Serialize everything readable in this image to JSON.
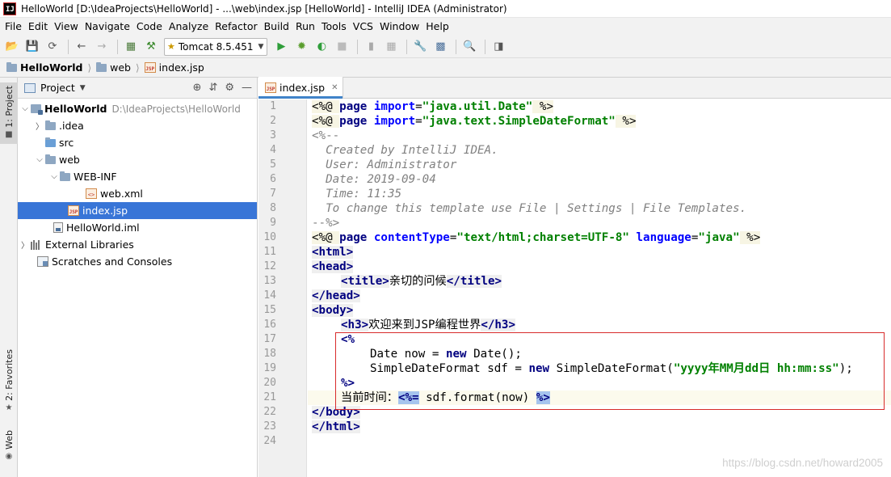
{
  "window": {
    "title": "HelloWorld [D:\\IdeaProjects\\HelloWorld] - ...\\web\\index.jsp [HelloWorld] - IntelliJ IDEA (Administrator)",
    "app_icon": "IJ"
  },
  "menu": [
    "File",
    "Edit",
    "View",
    "Navigate",
    "Code",
    "Analyze",
    "Refactor",
    "Build",
    "Run",
    "Tools",
    "VCS",
    "Window",
    "Help"
  ],
  "toolbar": {
    "run_config": "Tomcat 8.5.451"
  },
  "breadcrumb": [
    "HelloWorld",
    "web",
    "index.jsp"
  ],
  "left_strip": {
    "project_tab": "1: Project",
    "favorites_tab": "2: Favorites",
    "web_tab": "Web"
  },
  "project_panel": {
    "title": "Project",
    "tree": [
      {
        "label": "HelloWorld",
        "path": "D:\\IdeaProjects\\HelloWorld"
      },
      {
        "label": ".idea"
      },
      {
        "label": "src"
      },
      {
        "label": "web"
      },
      {
        "label": "WEB-INF"
      },
      {
        "label": "web.xml"
      },
      {
        "label": "index.jsp"
      },
      {
        "label": "HelloWorld.iml"
      },
      {
        "label": "External Libraries"
      },
      {
        "label": "Scratches and Consoles"
      }
    ]
  },
  "editor": {
    "tab_label": "index.jsp",
    "line_numbers": [
      "1",
      "2",
      "3",
      "4",
      "5",
      "6",
      "7",
      "8",
      "9",
      "10",
      "11",
      "12",
      "13",
      "14",
      "15",
      "16",
      "17",
      "18",
      "19",
      "20",
      "21",
      "22",
      "23",
      "24"
    ],
    "lines": {
      "l1": {
        "open": "<%@ ",
        "kw": "page",
        "attr": "import",
        "eq": "=",
        "str": "\"java.util.Date\"",
        "close": " %>"
      },
      "l2": {
        "open": "<%@ ",
        "kw": "page",
        "attr": "import",
        "eq": "=",
        "str": "\"java.text.SimpleDateFormat\"",
        "close": " %>"
      },
      "l3": "<%--",
      "l4": "  Created by IntelliJ IDEA.",
      "l5": "  User: Administrator",
      "l6": "  Date: 2019-09-04",
      "l7": "  Time: 11:35",
      "l8": "  To change this template use File | Settings | File Templates.",
      "l9": "--%>",
      "l10": {
        "open": "<%@ ",
        "kw": "page",
        "attr1": "contentType",
        "str1": "\"text/html;charset=UTF-8\"",
        "attr2": "language",
        "str2": "\"java\"",
        "close": " %>"
      },
      "l11": "<html>",
      "l12": "<head>",
      "l13": {
        "open": "<title>",
        "text": "亲切的问候",
        "close": "</title>"
      },
      "l14": "</head>",
      "l15": "<body>",
      "l16": {
        "open": "<h3>",
        "text": "欢迎来到JSP编程世界",
        "close": "</h3>"
      },
      "l17": "<%",
      "l18": {
        "type": "Date now = ",
        "kw": "new",
        "rest": " Date();"
      },
      "l19": {
        "type": "SimpleDateFormat sdf = ",
        "kw": "new",
        "rest": " SimpleDateFormat(",
        "str": "\"yyyy年MM月dd日 hh:mm:ss\"",
        "end": ");"
      },
      "l20": "%>",
      "l21": {
        "text": "当前时间：",
        "open": "<%=",
        "expr": " sdf.format(now) ",
        "close": "%>"
      },
      "l22": "</body>",
      "l23": "</html>"
    }
  },
  "watermark": "https://blog.csdn.net/howard2005"
}
